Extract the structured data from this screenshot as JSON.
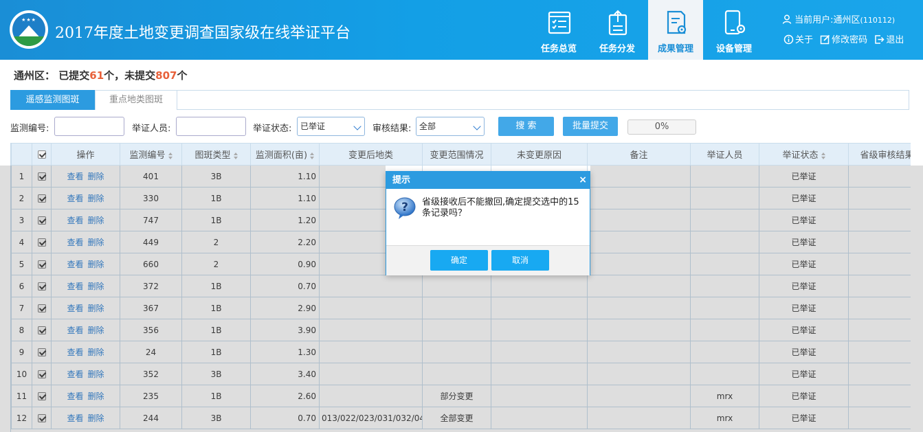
{
  "app": {
    "title": "2017年度土地变更调查国家级在线举证平台"
  },
  "nav": [
    {
      "label": "任务总览",
      "icon": "checklist-window-icon",
      "active": false
    },
    {
      "label": "任务分发",
      "icon": "clipboard-upload-icon",
      "active": false
    },
    {
      "label": "成果管理",
      "icon": "document-gear-icon",
      "active": true
    },
    {
      "label": "设备管理",
      "icon": "phone-gear-icon",
      "active": false
    }
  ],
  "user": {
    "label": "当前用户:",
    "name": "通州区",
    "code": "(110112)",
    "about": "关于",
    "change_password": "修改密码",
    "logout": "退出"
  },
  "summary": {
    "region": "通州区：",
    "submitted_prefix": "已提交",
    "submitted_count": "61",
    "submitted_unit": "个，",
    "unsubmitted_prefix": "未提交",
    "unsubmitted_count": "807",
    "unsubmitted_unit": "个"
  },
  "tabs": [
    {
      "label": "遥感监测图斑",
      "active": true
    },
    {
      "label": "重点地类图斑",
      "active": false
    }
  ],
  "filters": {
    "monitor_no_label": "监测编号:",
    "person_label": "举证人员:",
    "status_label": "举证状态:",
    "status_value": "已举证",
    "review_label": "审核结果:",
    "review_value": "全部",
    "search_button": "搜  索",
    "batch_button": "批量提交",
    "progress_text": "0%",
    "progress_value": 0
  },
  "table": {
    "headers": [
      "",
      "",
      "操作",
      "监测编号",
      "图斑类型",
      "监测面积(亩)",
      "变更后地类",
      "变更范围情况",
      "未变更原因",
      "备注",
      "举证人员",
      "举证状态",
      "省级审核结果"
    ],
    "view_label": "查看",
    "delete_label": "删除",
    "rows": [
      {
        "idx": "1",
        "no": "401",
        "type": "3B",
        "area": "1.10",
        "after": "",
        "scope": "",
        "reason": "",
        "note": "",
        "person": "",
        "status": "已举证",
        "review": ""
      },
      {
        "idx": "2",
        "no": "330",
        "type": "1B",
        "area": "1.10",
        "after": "",
        "scope": "",
        "reason": "",
        "note": "",
        "person": "",
        "status": "已举证",
        "review": ""
      },
      {
        "idx": "3",
        "no": "747",
        "type": "1B",
        "area": "1.20",
        "after": "",
        "scope": "",
        "reason": "",
        "note": "",
        "person": "",
        "status": "已举证",
        "review": ""
      },
      {
        "idx": "4",
        "no": "449",
        "type": "2",
        "area": "2.20",
        "after": "",
        "scope": "",
        "reason": "",
        "note": "",
        "person": "",
        "status": "已举证",
        "review": ""
      },
      {
        "idx": "5",
        "no": "660",
        "type": "2",
        "area": "0.90",
        "after": "",
        "scope": "",
        "reason": "",
        "note": "",
        "person": "",
        "status": "已举证",
        "review": ""
      },
      {
        "idx": "6",
        "no": "372",
        "type": "1B",
        "area": "0.70",
        "after": "",
        "scope": "",
        "reason": "",
        "note": "",
        "person": "",
        "status": "已举证",
        "review": ""
      },
      {
        "idx": "7",
        "no": "367",
        "type": "1B",
        "area": "2.90",
        "after": "",
        "scope": "",
        "reason": "",
        "note": "",
        "person": "",
        "status": "已举证",
        "review": ""
      },
      {
        "idx": "8",
        "no": "356",
        "type": "1B",
        "area": "3.90",
        "after": "",
        "scope": "",
        "reason": "",
        "note": "",
        "person": "",
        "status": "已举证",
        "review": ""
      },
      {
        "idx": "9",
        "no": "24",
        "type": "1B",
        "area": "1.30",
        "after": "",
        "scope": "",
        "reason": "",
        "note": "",
        "person": "",
        "status": "已举证",
        "review": ""
      },
      {
        "idx": "10",
        "no": "352",
        "type": "3B",
        "area": "3.40",
        "after": "",
        "scope": "",
        "reason": "",
        "note": "",
        "person": "",
        "status": "已举证",
        "review": ""
      },
      {
        "idx": "11",
        "no": "235",
        "type": "1B",
        "area": "2.60",
        "after": "",
        "scope": "部分变更",
        "reason": "",
        "note": "",
        "person": "mrx",
        "status": "已举证",
        "review": ""
      },
      {
        "idx": "12",
        "no": "244",
        "type": "3B",
        "area": "0.70",
        "after": "013/022/023/031/032/04",
        "scope": "全部变更",
        "reason": "",
        "note": "",
        "person": "mrx",
        "status": "已举证",
        "review": ""
      }
    ]
  },
  "dialog": {
    "title": "提示",
    "close": "×",
    "message": "省级接收后不能撤回,确定提交选中的15条记录吗？",
    "ok": "确定",
    "cancel": "取消"
  }
}
